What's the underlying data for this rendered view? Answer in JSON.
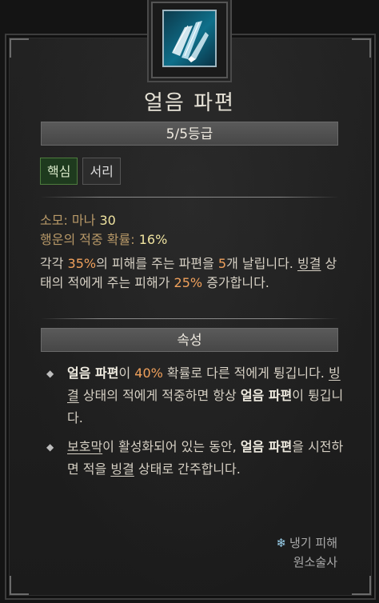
{
  "skill": {
    "name": "얼음 파편",
    "rank": "5/5등급",
    "tags": [
      "핵심",
      "서리"
    ],
    "stats": {
      "cost_label": "소모: 마나 ",
      "cost_value": "30",
      "luck_label": "행운의 적중 확률: ",
      "luck_value": "16%"
    },
    "description": {
      "p1": "각각 ",
      "v1": "35%",
      "p2": "의 피해를 주는 파편을 ",
      "v2": "5",
      "p3": "개 날립니다. ",
      "link1": "빙결",
      "p4": " 상태의 적에게 주는 피해가 ",
      "v3": "25%",
      "p5": " 증가합니다."
    },
    "properties_header": "속성",
    "properties": [
      {
        "b1": "얼음 파편",
        "t1": "이 ",
        "v1": "40%",
        "t2": " 확률로 다른 적에게 튕깁니다. ",
        "link1": "빙결",
        "t3": " 상태의 적에게 적중하면 항상 ",
        "b2": "얼음 파편",
        "t4": "이 튕깁니다."
      },
      {
        "link1": "보호막",
        "t1": "이 활성화되어 있는 동안, ",
        "b1": "얼음 파편",
        "t2": "을 시전하면 적을 ",
        "link2": "빙결",
        "t3": " 상태로 간주합니다."
      }
    ],
    "footer": {
      "damage_type": "냉기 피해",
      "class_name": "원소술사"
    },
    "icons": {
      "skill_icon": "ice-shards-icon",
      "bullet_icon": "diamond-bullet-icon",
      "damage_icon": "snowflake-icon"
    },
    "colors": {
      "highlight": "#f0a15c",
      "stat_value": "#efe3a0",
      "tag_core": "#1e3a1e"
    }
  }
}
